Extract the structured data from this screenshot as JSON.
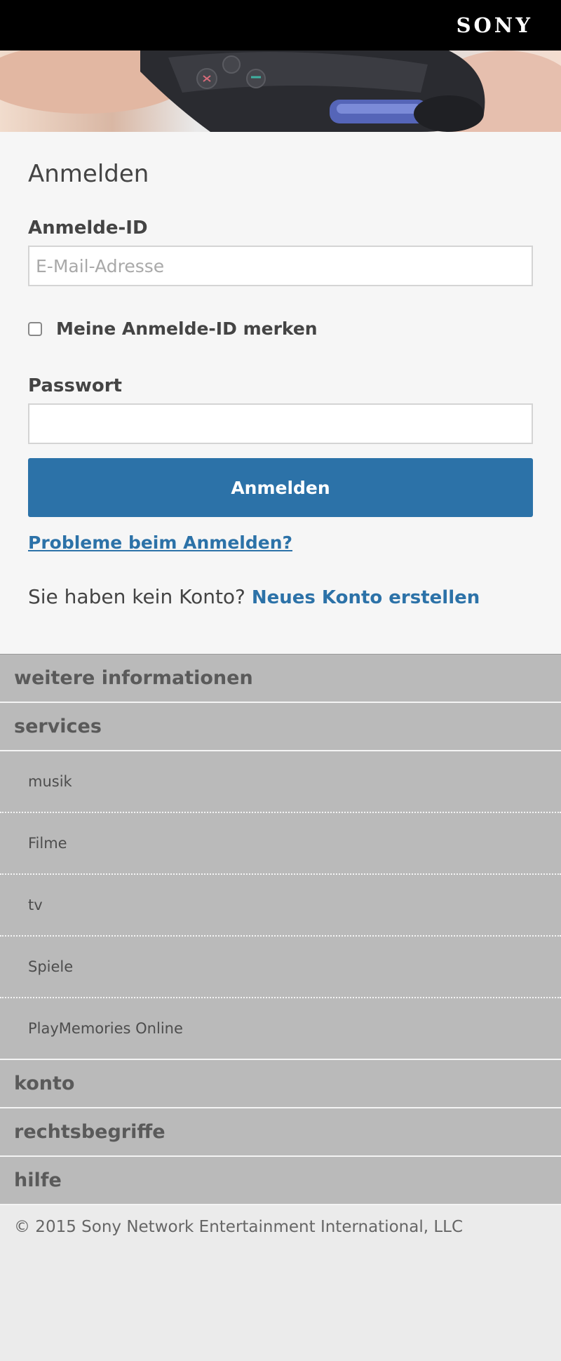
{
  "header": {
    "brand": "SONY"
  },
  "hero": {
    "image": "playstation-controller-photo"
  },
  "login": {
    "title": "Anmelden",
    "id_label": "Anmelde-ID",
    "id_placeholder": "E-Mail-Adresse",
    "id_value": "",
    "remember_label": "Meine Anmelde-ID merken",
    "remember_checked": false,
    "password_label": "Passwort",
    "password_value": "",
    "submit_label": "Anmelden",
    "trouble_link": "Probleme beim Anmelden?",
    "no_account_text": "Sie haben kein Konto?",
    "create_account_link": "Neues Konto erstellen"
  },
  "nav": {
    "more_info": "weitere informationen",
    "services": "services",
    "service_items": [
      "musik",
      "Filme",
      "tv",
      "Spiele",
      "PlayMemories Online"
    ],
    "account": "konto",
    "legal": "rechtsbegriffe",
    "help": "hilfe"
  },
  "footer": {
    "copyright": "© 2015 Sony Network Entertainment International, LLC"
  },
  "colors": {
    "accent": "#2c72a8",
    "topbar": "#000000",
    "nav_bg": "#bababa",
    "page_bg": "#ebebeb"
  }
}
